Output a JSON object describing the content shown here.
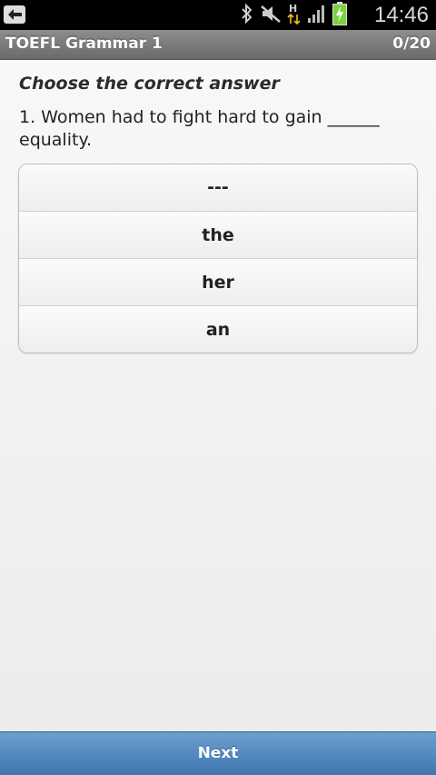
{
  "status_bar": {
    "time": "14:46",
    "icons": [
      "back-icon",
      "bluetooth-icon",
      "mute-icon",
      "hsdpa-icon",
      "signal-icon",
      "battery-charging-icon"
    ],
    "network_label": "H"
  },
  "header": {
    "title": "TOEFL Grammar 1",
    "progress": "0/20"
  },
  "main": {
    "instruction": "Choose the correct answer",
    "question": "1. Women had to fight hard to gain ______ equality.",
    "options": [
      {
        "label": "---"
      },
      {
        "label": "the"
      },
      {
        "label": "her"
      },
      {
        "label": "an"
      }
    ]
  },
  "footer": {
    "next_label": "Next"
  },
  "colors": {
    "title_bar": "#7c7c7c",
    "next_button": "#4f85bd",
    "battery": "#7bd23c"
  }
}
